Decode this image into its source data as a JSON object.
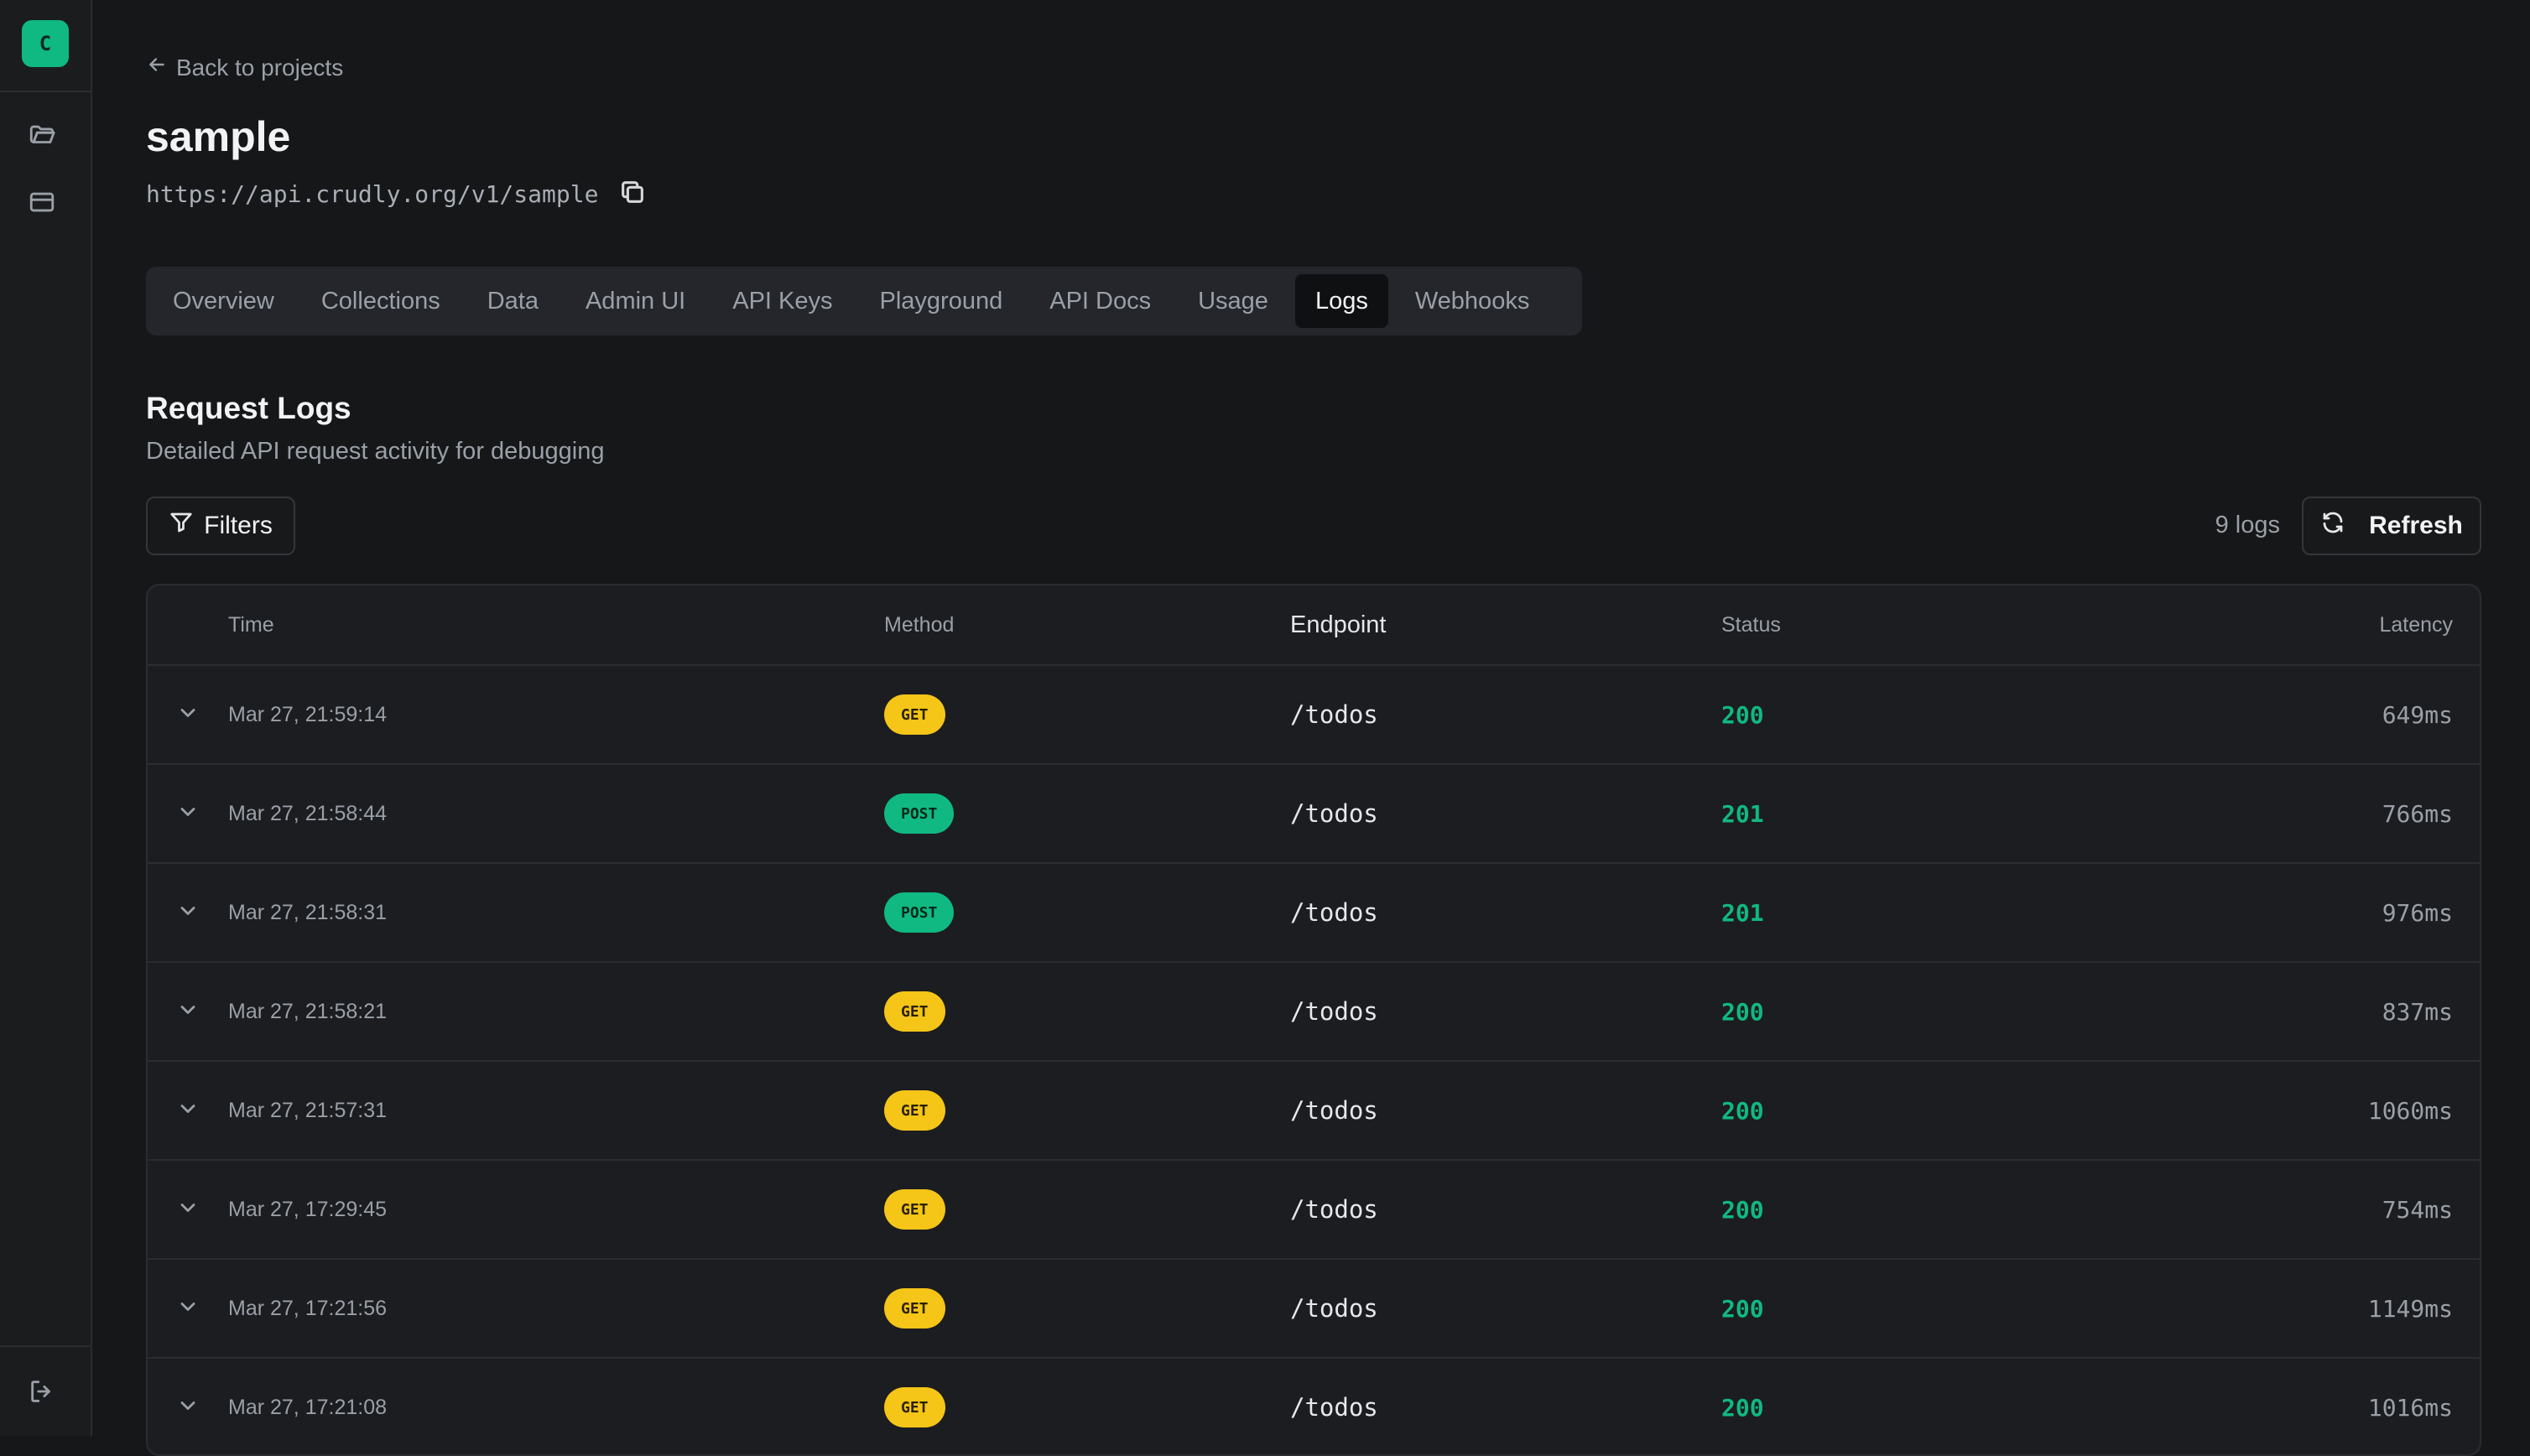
{
  "sidebar": {
    "logo_letter": "C",
    "icons": [
      "folder-icon",
      "card-icon",
      "logout-icon"
    ]
  },
  "header": {
    "back_label": "Back to projects",
    "project_name": "sample",
    "api_url": "https://api.crudly.org/v1/sample"
  },
  "tabs": [
    {
      "label": "Overview"
    },
    {
      "label": "Collections"
    },
    {
      "label": "Data"
    },
    {
      "label": "Admin UI"
    },
    {
      "label": "API Keys"
    },
    {
      "label": "Playground"
    },
    {
      "label": "API Docs"
    },
    {
      "label": "Usage"
    },
    {
      "label": "Logs",
      "active": true
    },
    {
      "label": "Webhooks"
    }
  ],
  "section": {
    "title": "Request Logs",
    "subtitle": "Detailed API request activity for debugging"
  },
  "toolbar": {
    "filters_label": "Filters",
    "log_count": "9 logs",
    "refresh_label": "Refresh"
  },
  "table": {
    "columns": {
      "time": "Time",
      "method": "Method",
      "endpoint": "Endpoint",
      "status": "Status",
      "latency": "Latency"
    },
    "rows": [
      {
        "time": "Mar 27, 21:59:14",
        "method": "GET",
        "endpoint": "/todos",
        "status": "200",
        "latency": "649ms"
      },
      {
        "time": "Mar 27, 21:58:44",
        "method": "POST",
        "endpoint": "/todos",
        "status": "201",
        "latency": "766ms"
      },
      {
        "time": "Mar 27, 21:58:31",
        "method": "POST",
        "endpoint": "/todos",
        "status": "201",
        "latency": "976ms"
      },
      {
        "time": "Mar 27, 21:58:21",
        "method": "GET",
        "endpoint": "/todos",
        "status": "200",
        "latency": "837ms"
      },
      {
        "time": "Mar 27, 21:57:31",
        "method": "GET",
        "endpoint": "/todos",
        "status": "200",
        "latency": "1060ms"
      },
      {
        "time": "Mar 27, 17:29:45",
        "method": "GET",
        "endpoint": "/todos",
        "status": "200",
        "latency": "754ms"
      },
      {
        "time": "Mar 27, 17:21:56",
        "method": "GET",
        "endpoint": "/todos",
        "status": "200",
        "latency": "1149ms"
      },
      {
        "time": "Mar 27, 17:21:08",
        "method": "GET",
        "endpoint": "/todos",
        "status": "200",
        "latency": "1016ms"
      }
    ]
  },
  "colors": {
    "accent": "#10b981",
    "get_badge": "#f5c518",
    "post_badge": "#10b981",
    "background": "#161718"
  }
}
